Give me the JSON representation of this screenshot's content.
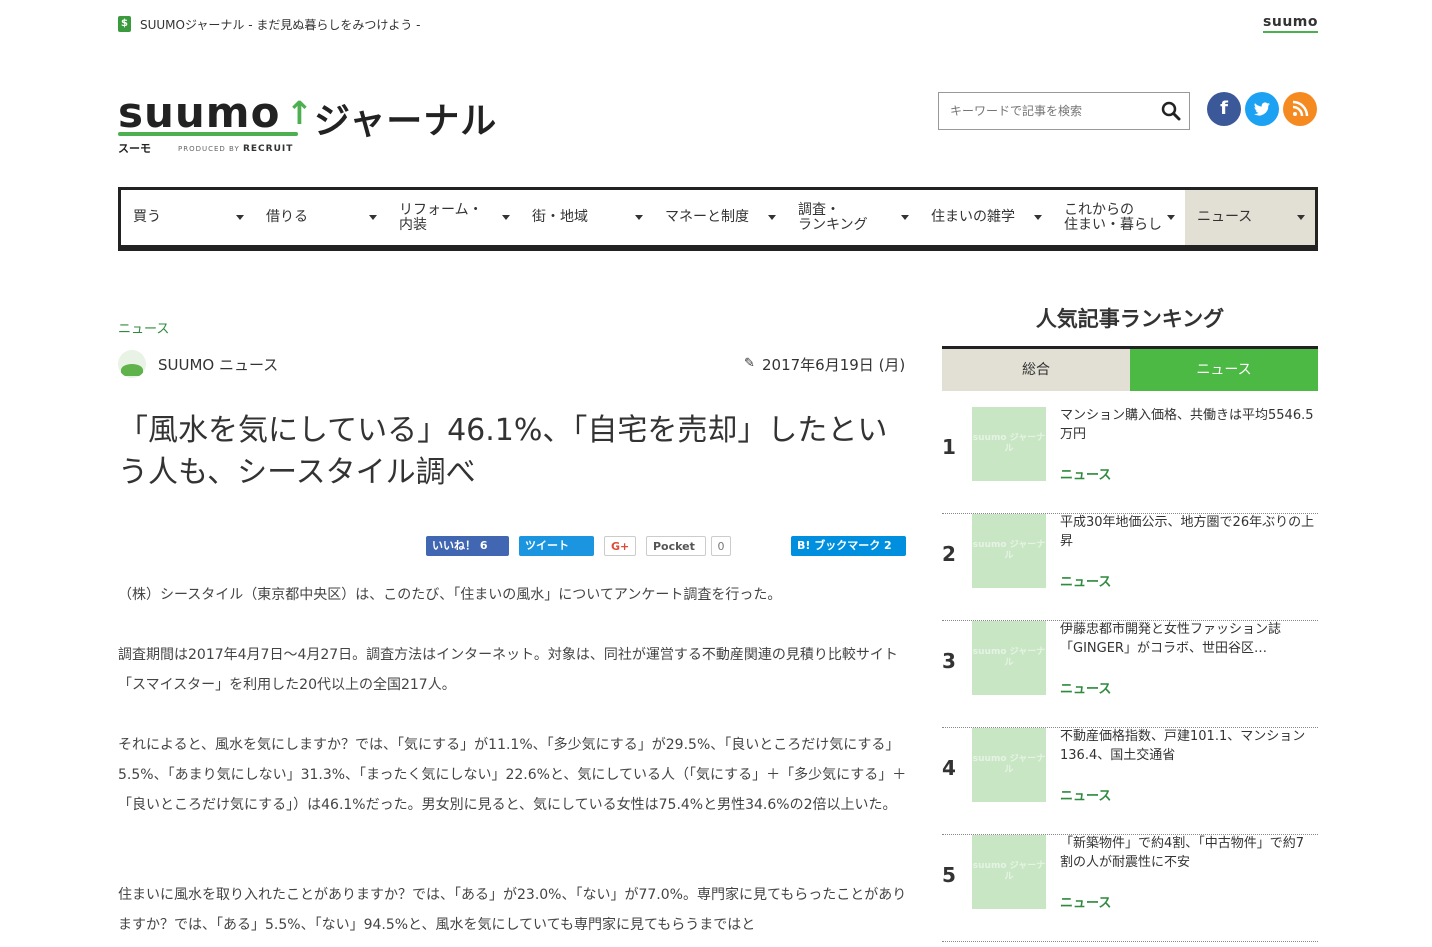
{
  "header": {
    "tagline": "SUUMOジャーナル - まだ見ぬ暮らしをみつけよう -",
    "top_logo": "suumo",
    "logo_suumo": "suumo",
    "logo_journal": "ジャーナル",
    "logo_kana": "スーモ",
    "produced_by": "PRODUCED BY",
    "recruit": "RECRUIT",
    "search_placeholder": "キーワードで記事を検索"
  },
  "nav": {
    "items": [
      {
        "label": "買う"
      },
      {
        "label": "借りる"
      },
      {
        "label": "リフォーム・\n内装"
      },
      {
        "label": "街・地域"
      },
      {
        "label": "マネーと制度"
      },
      {
        "label": "調査・\nランキング"
      },
      {
        "label": "住まいの雑学"
      },
      {
        "label": "これからの\n住まい・暮らし"
      },
      {
        "label": "ニュース"
      }
    ]
  },
  "article": {
    "category": "ニュース",
    "author": "SUUMO ニュース",
    "date": "2017年6月19日 (月)",
    "title": "「風水を気にしている」46.1%、「自宅を売却」したという人も、シースタイル調べ",
    "share": {
      "like": "いいね！ 6",
      "tweet": "ツイート",
      "gplus": "G+",
      "pocket": "Pocket",
      "pocket_count": "0",
      "hatena": "B! ブックマーク 2"
    },
    "paragraphs": [
      "（株）シースタイル（東京都中央区）は、このたび、「住まいの風水」についてアンケート調査を行った。",
      "調査期間は2017年4月7日～4月27日。調査方法はインターネット。対象は、同社が運営する不動産関連の見積り比較サイト「スマイスター」を利用した20代以上の全国217人。",
      "それによると、風水を気にしますか？では、「気にする」が11.1%、「多少気にする」が29.5%、「良いところだけ気にする」5.5%、「あまり気にしない」31.3%、「まったく気にしない」22.6%と、気にしている人（「気にする」＋「多少気にする」＋「良いところだけ気にする」）は46.1%だった。男女別に見ると、気にしている女性は75.4%と男性34.6%の2倍以上いた。",
      "住まいに風水を取り入れたことがありますか？では、「ある」が23.0%、「ない」が77.0%。専門家に見てもらったことがありますか？では、「ある」5.5%、「ない」94.5%と、風水を気にしていても専門家に見てもらうまではと"
    ]
  },
  "sidebar": {
    "title": "人気記事ランキング",
    "tabs": {
      "all": "総合",
      "news": "ニュース"
    },
    "thumb_text": "suumo ジャーナル",
    "items": [
      {
        "rank": "1",
        "headline": "マンション購入価格、共働きは平均5546.5万円",
        "tag": "ニュース"
      },
      {
        "rank": "2",
        "headline": "平成30年地価公示、地方圏で26年ぶりの上昇",
        "tag": "ニュース"
      },
      {
        "rank": "3",
        "headline": "伊藤忠都市開発と女性ファッション誌「GINGER」がコラボ、世田谷区…",
        "tag": "ニュース"
      },
      {
        "rank": "4",
        "headline": "不動産価格指数、戸建101.1、マンション136.4、国土交通省",
        "tag": "ニュース"
      },
      {
        "rank": "5",
        "headline": "「新築物件」で約4割、「中古物件」で約7割の人が耐震性に不安",
        "tag": "ニュース"
      }
    ]
  },
  "colors": {
    "accent_green": "#4cb944",
    "link_green": "#2e8b3d",
    "facebook": "#3b5998",
    "twitter": "#1da1f2",
    "rss": "#f58a20",
    "active_tab_bg": "#e2dfd5"
  }
}
